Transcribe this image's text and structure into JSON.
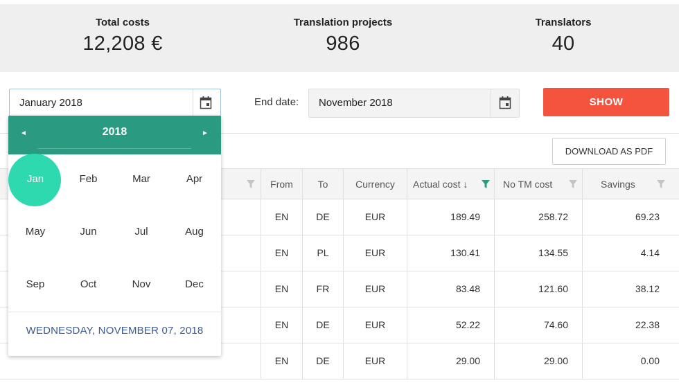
{
  "stats": [
    {
      "label": "Total costs",
      "value": "12,208 €"
    },
    {
      "label": "Translation projects",
      "value": "986"
    },
    {
      "label": "Translators",
      "value": "40"
    }
  ],
  "filters": {
    "start_value": "January 2018",
    "end_label": "End date:",
    "end_value": "November 2018",
    "show_label": "SHOW",
    "download_label": "DOWNLOAD AS PDF"
  },
  "table": {
    "columns": [
      "From",
      "To",
      "Currency",
      "Actual cost ↓",
      "No TM cost",
      "Savings"
    ],
    "rows": [
      [
        "EN",
        "DE",
        "EUR",
        "189.49",
        "258.72",
        "69.23"
      ],
      [
        "EN",
        "PL",
        "EUR",
        "130.41",
        "134.55",
        "4.14"
      ],
      [
        "EN",
        "FR",
        "EUR",
        "83.48",
        "121.60",
        "38.12"
      ],
      [
        "EN",
        "DE",
        "EUR",
        "52.22",
        "74.60",
        "22.38"
      ],
      [
        "EN",
        "DE",
        "EUR",
        "29.00",
        "29.00",
        "0.00"
      ]
    ]
  },
  "calendar": {
    "year": "2018",
    "prev_icon": "◄",
    "next_icon": "►",
    "months": [
      "Jan",
      "Feb",
      "Mar",
      "Apr",
      "May",
      "Jun",
      "Jul",
      "Aug",
      "Sep",
      "Oct",
      "Nov",
      "Dec"
    ],
    "selected_month": "Jan",
    "today_label": "WEDNESDAY, NOVEMBER 07, 2018"
  },
  "colors": {
    "accent_red": "#f4533e",
    "calendar_header": "#2a9a80",
    "selected_month": "#2fd9b0",
    "active_filter": "#2a9a80"
  },
  "icons": [
    "calendar-icon",
    "filter-icon",
    "chevron-left-icon",
    "chevron-right-icon"
  ]
}
